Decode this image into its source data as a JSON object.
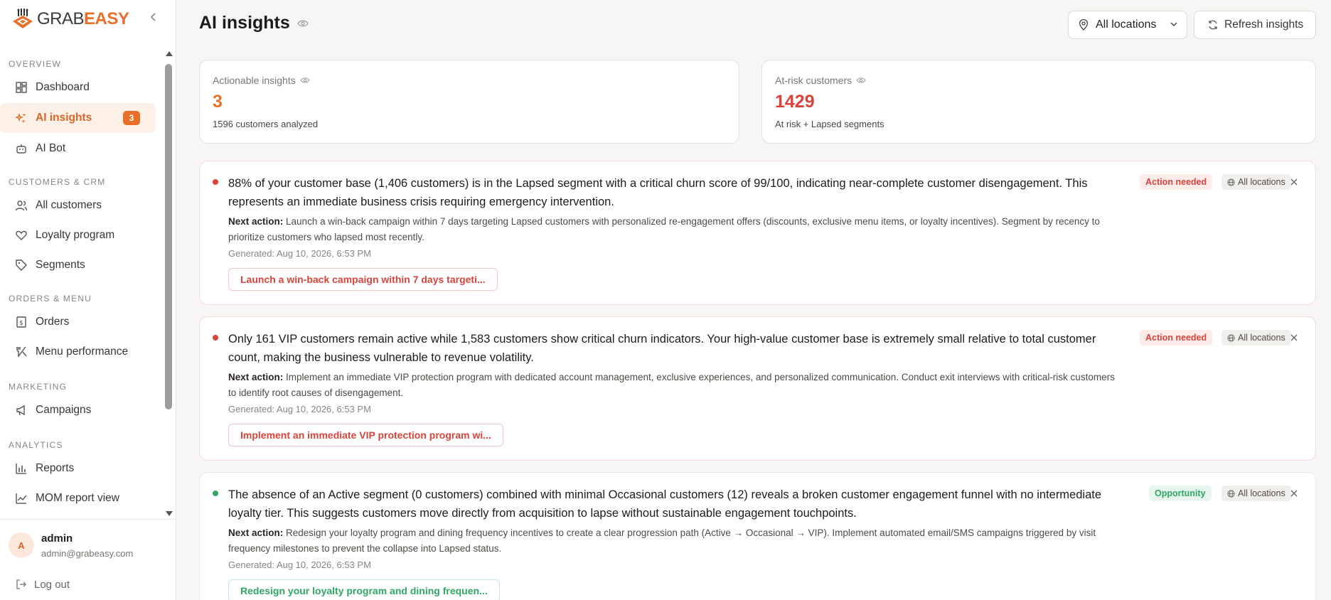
{
  "brand": {
    "text_part1": "GRAB",
    "text_part2": "EASY",
    "accent": "#e8702a"
  },
  "sidebar": {
    "sections": [
      {
        "label": "OVERVIEW"
      },
      {
        "label": "CUSTOMERS & CRM"
      },
      {
        "label": "ORDERS & MENU"
      },
      {
        "label": "MARKETING"
      },
      {
        "label": "ANALYTICS"
      }
    ],
    "items": [
      {
        "label": "Dashboard",
        "icon": "dashboard-icon"
      },
      {
        "label": "AI insights",
        "icon": "sparkle-icon",
        "active": true,
        "badge": "3"
      },
      {
        "label": "AI Bot",
        "icon": "bot-icon"
      },
      {
        "label": "All customers",
        "icon": "users-icon"
      },
      {
        "label": "Loyalty program",
        "icon": "heart-icon"
      },
      {
        "label": "Segments",
        "icon": "tag-icon"
      },
      {
        "label": "Orders",
        "icon": "receipt-icon"
      },
      {
        "label": "Menu performance",
        "icon": "utensils-icon"
      },
      {
        "label": "Campaigns",
        "icon": "megaphone-icon"
      },
      {
        "label": "Reports",
        "icon": "bar-chart-icon"
      },
      {
        "label": "MOM report view",
        "icon": "line-chart-icon"
      }
    ],
    "user": {
      "initial": "A",
      "name": "admin",
      "email": "admin@grabeasy.com"
    },
    "logout_label": "Log out"
  },
  "header": {
    "title": "AI insights",
    "location_select": "All locations",
    "refresh_label": "Refresh insights"
  },
  "stats": {
    "actionable": {
      "label": "Actionable insights",
      "value": "3",
      "sub": "1596 customers analyzed",
      "color": "#e8702a"
    },
    "at_risk": {
      "label": "At-risk customers",
      "value": "1429",
      "sub": "At risk + Lapsed segments",
      "color": "#d8443b"
    }
  },
  "insights": [
    {
      "title": "88% of your customer base (1,406 customers) is in the Lapsed segment with a critical churn score of 99/100, indicating near-complete customer disengagement. This represents an immediate business crisis requiring emergency intervention.",
      "next_label": "Next action:",
      "next_text": "Launch a win-back campaign within 7 days targeting Lapsed customers with personalized re-engagement offers (discounts, exclusive menu items, or loyalty incentives). Segment by recency to prioritize customers who lapsed most recently.",
      "generated": "Generated: Aug 10, 2026, 6:53 PM",
      "action": "Launch a win-back campaign within 7 days targeti...",
      "tag": "Action needed",
      "location": "All locations",
      "status_color": "#d8443b"
    },
    {
      "title": "Only 161 VIP customers remain active while 1,583 customers show critical churn indicators. Your high-value customer base is extremely small relative to total customer count, making the business vulnerable to revenue volatility.",
      "next_label": "Next action:",
      "next_text": "Implement an immediate VIP protection program with dedicated account management, exclusive experiences, and personalized communication. Conduct exit interviews with critical-risk customers to identify root causes of disengagement.",
      "generated": "Generated: Aug 10, 2026, 6:53 PM",
      "action": "Implement an immediate VIP protection program wi...",
      "tag": "Action needed",
      "location": "All locations",
      "status_color": "#d8443b"
    },
    {
      "title": "The absence of an Active segment (0 customers) combined with minimal Occasional customers (12) reveals a broken customer engagement funnel with no intermediate loyalty tier. This suggests customers move directly from acquisition to lapse without sustainable engagement touchpoints.",
      "next_label": "Next action:",
      "next_text": "Redesign your loyalty program and dining frequency incentives to create a clear progression path (Active → Occasional → VIP). Implement automated email/SMS campaigns triggered by visit frequency milestones to prevent the collapse into Lapsed status.",
      "generated": "Generated: Aug 10, 2026, 6:53 PM",
      "action": "Redesign your loyalty program and dining frequen...",
      "tag": "Opportunity",
      "location": "All locations",
      "status_color": "#2fa866"
    }
  ]
}
